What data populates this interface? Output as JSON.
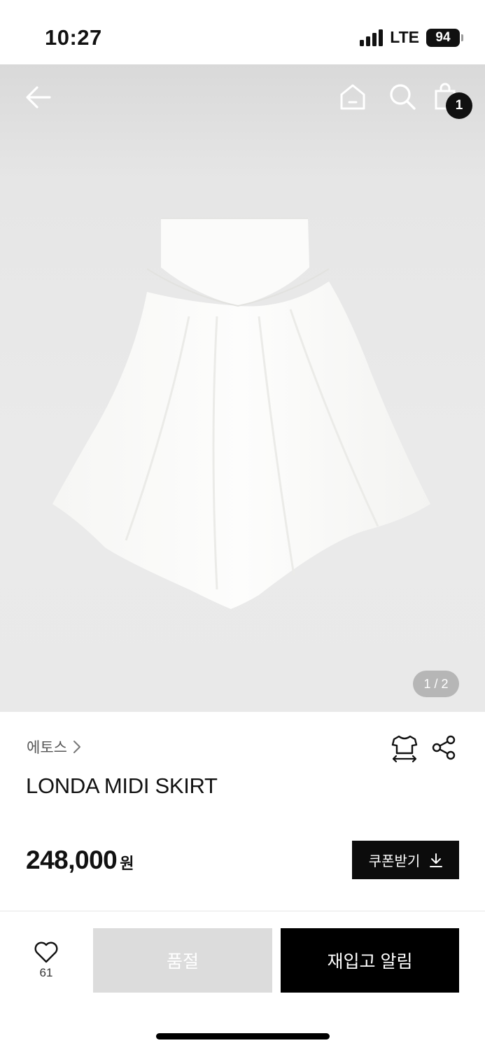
{
  "status": {
    "time": "10:27",
    "network": "LTE",
    "battery": "94"
  },
  "topbar": {
    "cart_count": "1"
  },
  "gallery": {
    "counter": "1 / 2"
  },
  "product": {
    "brand": "에토스",
    "name": "LONDA MIDI SKIRT",
    "price": "248,000",
    "currency": "원"
  },
  "coupon": {
    "label": "쿠폰받기"
  },
  "bottom_bar": {
    "like_count": "61",
    "soldout_label": "품절",
    "restock_label": "재입고 알림"
  },
  "colors": {
    "accent": "#000000",
    "disabled": "#dcdcdc",
    "hero_background": "#e9e9e9"
  }
}
